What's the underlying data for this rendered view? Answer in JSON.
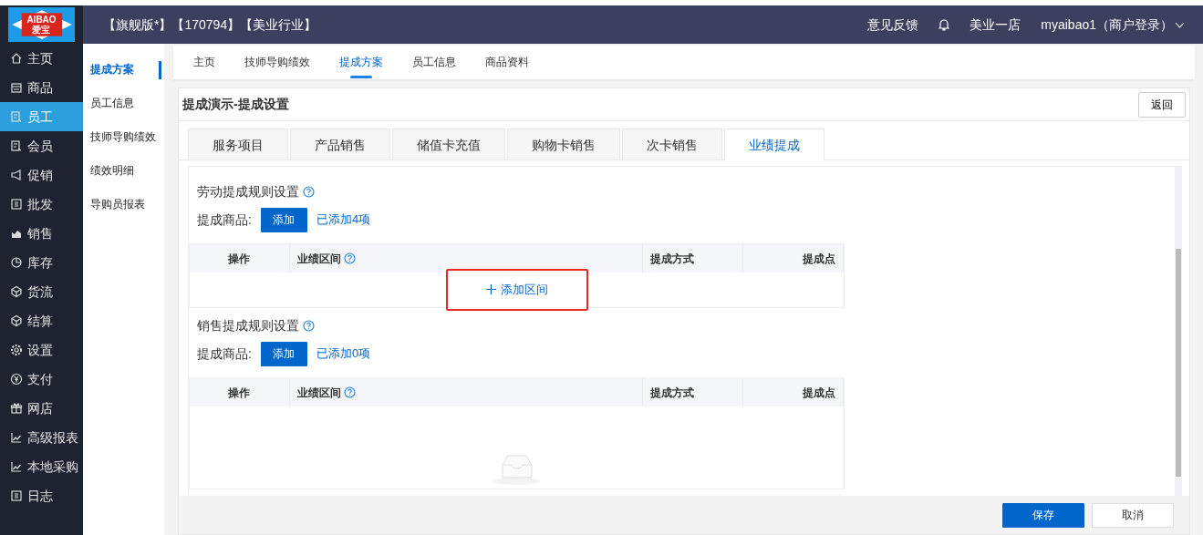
{
  "logo": {
    "text": "AIBAO",
    "subtext": "爱宝"
  },
  "header": {
    "title": "【旗舰版*】【170794】【美业行业】",
    "feedback": "意见反馈",
    "store": "美业一店",
    "user": "myaibao1（商户登录）"
  },
  "sidebar": {
    "items": [
      {
        "label": "主页",
        "kind": "home",
        "selected": false
      },
      {
        "label": "商品",
        "kind": "goods",
        "selected": false
      },
      {
        "label": "员工",
        "kind": "staff",
        "selected": true
      },
      {
        "label": "会员",
        "kind": "staff",
        "selected": false
      },
      {
        "label": "促销",
        "kind": "promo",
        "selected": false
      },
      {
        "label": "批发",
        "kind": "doc",
        "selected": false
      },
      {
        "label": "销售",
        "kind": "area",
        "selected": false
      },
      {
        "label": "库存",
        "kind": "pie",
        "selected": false
      },
      {
        "label": "货流",
        "kind": "cube",
        "selected": false
      },
      {
        "label": "结算",
        "kind": "cube",
        "selected": false
      },
      {
        "label": "设置",
        "kind": "gear",
        "selected": false
      },
      {
        "label": "支付",
        "kind": "yen",
        "selected": false
      },
      {
        "label": "网店",
        "kind": "gift",
        "selected": false
      },
      {
        "label": "高级报表",
        "kind": "line",
        "selected": false
      },
      {
        "label": "本地采购",
        "kind": "line",
        "selected": false
      },
      {
        "label": "日志",
        "kind": "doc",
        "selected": false
      }
    ]
  },
  "subnav": {
    "items": [
      {
        "label": "提成方案",
        "selected": true
      },
      {
        "label": "员工信息",
        "selected": false
      },
      {
        "label": "技师导购绩效",
        "selected": false
      },
      {
        "label": "绩效明细",
        "selected": false
      },
      {
        "label": "导购员报表",
        "selected": false
      }
    ]
  },
  "top_tabs": [
    {
      "label": "主页",
      "selected": false
    },
    {
      "label": "技师导购绩效",
      "selected": false
    },
    {
      "label": "提成方案",
      "selected": true
    },
    {
      "label": "员工信息",
      "selected": false
    },
    {
      "label": "商品资料",
      "selected": false
    }
  ],
  "page": {
    "title": "提成演示-提成设置",
    "back_button": "返回"
  },
  "category_tabs": [
    {
      "label": "服务项目",
      "selected": false
    },
    {
      "label": "产品销售",
      "selected": false
    },
    {
      "label": "储值卡充值",
      "selected": false
    },
    {
      "label": "购物卡销售",
      "selected": false
    },
    {
      "label": "次卡销售",
      "selected": false
    },
    {
      "label": "业绩提成",
      "selected": true
    }
  ],
  "sections": [
    {
      "title": "劳动提成规则设置",
      "goods_label": "提成商品:",
      "add_button": "添加",
      "added_link": "已添加4项",
      "columns": [
        "操作",
        "业绩区间",
        "提成方式",
        "提成点"
      ],
      "body": {
        "kind": "add_range",
        "text": "添加区间",
        "highlighted": true
      }
    },
    {
      "title": "销售提成规则设置",
      "goods_label": "提成商品:",
      "add_button": "添加",
      "added_link": "已添加0项",
      "columns": [
        "操作",
        "业绩区间",
        "提成方式",
        "提成点"
      ],
      "body": {
        "kind": "empty"
      }
    }
  ],
  "footer": {
    "buttons": [
      {
        "label": "保存",
        "kind": "primary"
      },
      {
        "label": "取消",
        "kind": "secondary"
      }
    ]
  }
}
